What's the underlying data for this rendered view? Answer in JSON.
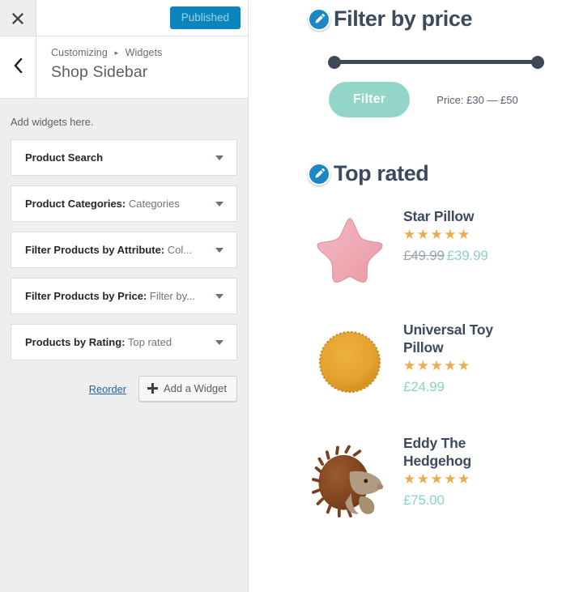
{
  "customizer": {
    "close_icon": "close-icon",
    "publish_label": "Published",
    "back_icon": "chevron-left-icon",
    "breadcrumb_root": "Customizing",
    "breadcrumb_separator": "▸",
    "breadcrumb_current": "Widgets",
    "panel_title": "Shop Sidebar",
    "description": "Add widgets here.",
    "widgets": [
      {
        "title": "Product Search",
        "subtitle": "",
        "toggle_icon": "chevron-down-icon"
      },
      {
        "title": "Product Categories:",
        "subtitle": " Categories",
        "toggle_icon": "chevron-down-icon"
      },
      {
        "title": "Filter Products by Attribute:",
        "subtitle": " Col...",
        "toggle_icon": "chevron-down-icon"
      },
      {
        "title": "Filter Products by Price:",
        "subtitle": " Filter by...",
        "toggle_icon": "chevron-down-icon"
      },
      {
        "title": "Products by Rating:",
        "subtitle": " Top rated",
        "toggle_icon": "chevron-down-icon"
      }
    ],
    "reorder_label": "Reorder",
    "add_widget_label": "Add a Widget",
    "add_widget_icon": "plus-icon"
  },
  "preview": {
    "price_widget": {
      "edit_icon": "pencil-edit-icon",
      "heading": "Filter by price",
      "slider": {
        "min_handle": "slider-handle-min",
        "max_handle": "slider-handle-max"
      },
      "filter_button": "Filter",
      "price_range_label": "Price: £30 — £50"
    },
    "top_rated_widget": {
      "edit_icon": "pencil-edit-icon",
      "heading": "Top rated",
      "products": [
        {
          "name": "Star Pillow",
          "stars": "★★★★★",
          "rating": 5,
          "old_price": "£49.99",
          "price": "£39.99",
          "image": "star-pillow-thumbnail"
        },
        {
          "name": "Universal Toy Pillow",
          "stars": "★★★★★",
          "rating": 5,
          "old_price": "",
          "price": "£24.99",
          "image": "round-pillow-thumbnail"
        },
        {
          "name": "Eddy The Hedgehog",
          "stars": "★★★★★",
          "rating": 5,
          "old_price": "",
          "price": "£75.00",
          "image": "hedgehog-toy-thumbnail"
        }
      ]
    }
  },
  "colors": {
    "publish_blue": "#0c84bc",
    "edit_icon_blue": "#1b87c4",
    "filter_button_mint": "#93d6c8",
    "price_mint": "#8ad3c6",
    "star_orange": "#edab4b",
    "heading_navy": "#3b4a5e",
    "slider_navy": "#3e4859",
    "sidebar_bg": "#eeeeee"
  }
}
